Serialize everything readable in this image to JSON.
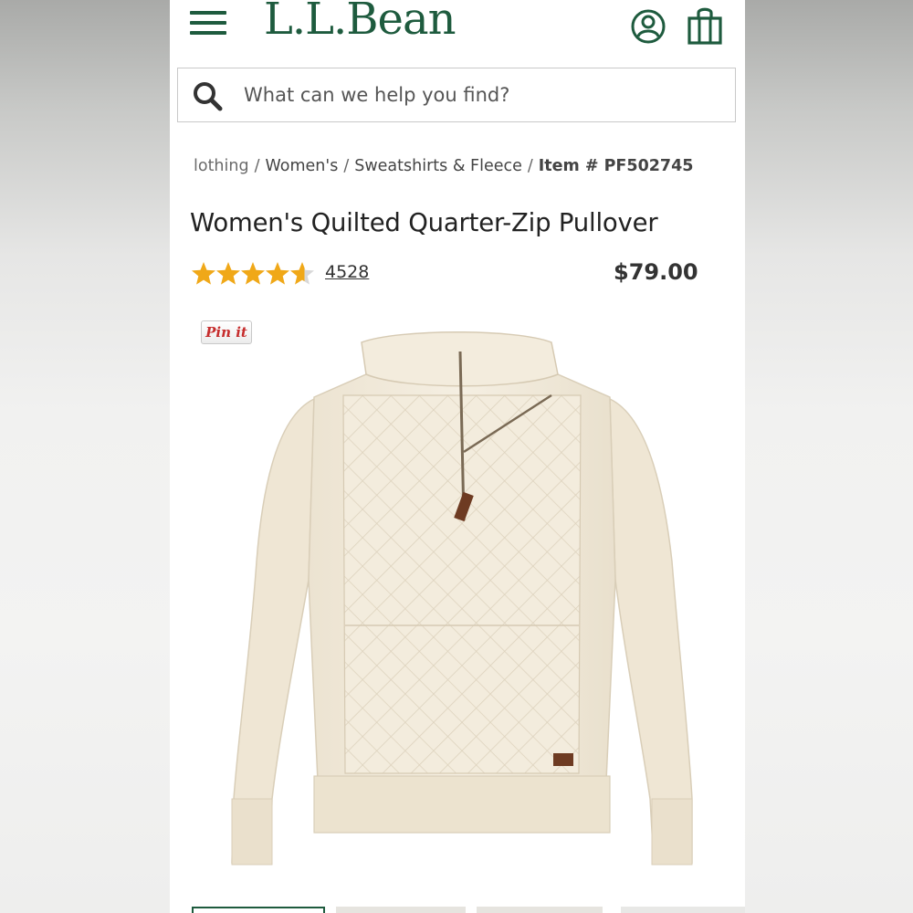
{
  "header": {
    "brand": "L.L.Bean",
    "menu_icon": "hamburger-menu-icon",
    "account_icon": "user-account-icon",
    "cart_icon": "shopping-tote-icon",
    "brand_color": "#1e5b3e"
  },
  "search": {
    "placeholder": "What can we help you find?",
    "value": "",
    "icon": "search-icon"
  },
  "breadcrumb": {
    "items": [
      "lothing",
      "Women's",
      "Sweatshirts & Fleece"
    ],
    "separator": "/",
    "item_number": "Item # PF502745"
  },
  "product": {
    "title": "Women's Quilted Quarter-Zip Pullover",
    "rating": 4.6,
    "rating_max": 5,
    "review_count": "4528",
    "price": "$79.00",
    "pin_label": "Pin it",
    "star_color": "#f0a818"
  },
  "gallery": {
    "thumbnail_count": 4,
    "selected_index": 0
  }
}
